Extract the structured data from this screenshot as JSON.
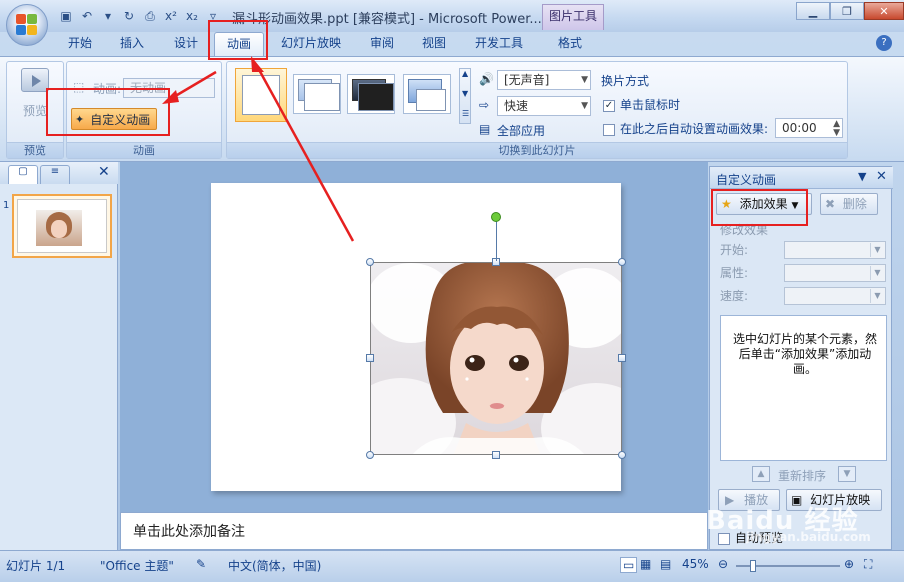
{
  "title": {
    "app_title": "漏斗形动画效果.ppt [兼容模式] - Microsoft Power...",
    "context_tool": "图片工具"
  },
  "tabs": [
    {
      "label": "开始"
    },
    {
      "label": "插入"
    },
    {
      "label": "设计"
    },
    {
      "label": "动画"
    },
    {
      "label": "幻灯片放映"
    },
    {
      "label": "审阅"
    },
    {
      "label": "视图"
    },
    {
      "label": "开发工具"
    },
    {
      "label": "格式"
    }
  ],
  "active_tab": "动画",
  "ribbon": {
    "preview_group": {
      "button": "预览",
      "label": "预览"
    },
    "animation_group": {
      "animation_label": "动画:",
      "animation_value": "无动画",
      "custom_animation": "自定义动画",
      "label": "动画"
    },
    "transition_group": {
      "sound_value": "[无声音]",
      "speed_value": "快速",
      "apply_all": "全部应用",
      "advance_title": "换片方式",
      "on_click": "单击鼠标时",
      "on_click_checked": true,
      "auto_after": "在此之后自动设置动画效果:",
      "auto_after_checked": false,
      "time_value": "00:00",
      "label": "切换到此幻灯片"
    }
  },
  "slides_pane": {
    "slide_number": "1"
  },
  "notes": {
    "placeholder": "单击此处添加备注"
  },
  "task_pane": {
    "title": "自定义动画",
    "add_effect": "添加效果",
    "remove": "删除",
    "modify_label": "修改效果",
    "start_label": "开始:",
    "property_label": "属性:",
    "speed_label": "速度:",
    "hint": "选中幻灯片的某个元素，然后单击“添加效果”添加动画。",
    "reorder": "重新排序",
    "play": "播放",
    "slideshow": "幻灯片放映",
    "autopreview": "自动预览"
  },
  "status": {
    "slide_info": "幻灯片 1/1",
    "theme": "\"Office 主题\"",
    "language": "中文(简体，中国)",
    "zoom": "45%"
  },
  "watermark": {
    "brand": "Baidu 经验",
    "url": "jingyan.baidu.com"
  },
  "colors": {
    "annotation": "#e62020",
    "highlight": "#f2a548",
    "ribbon_text": "#15428b"
  }
}
